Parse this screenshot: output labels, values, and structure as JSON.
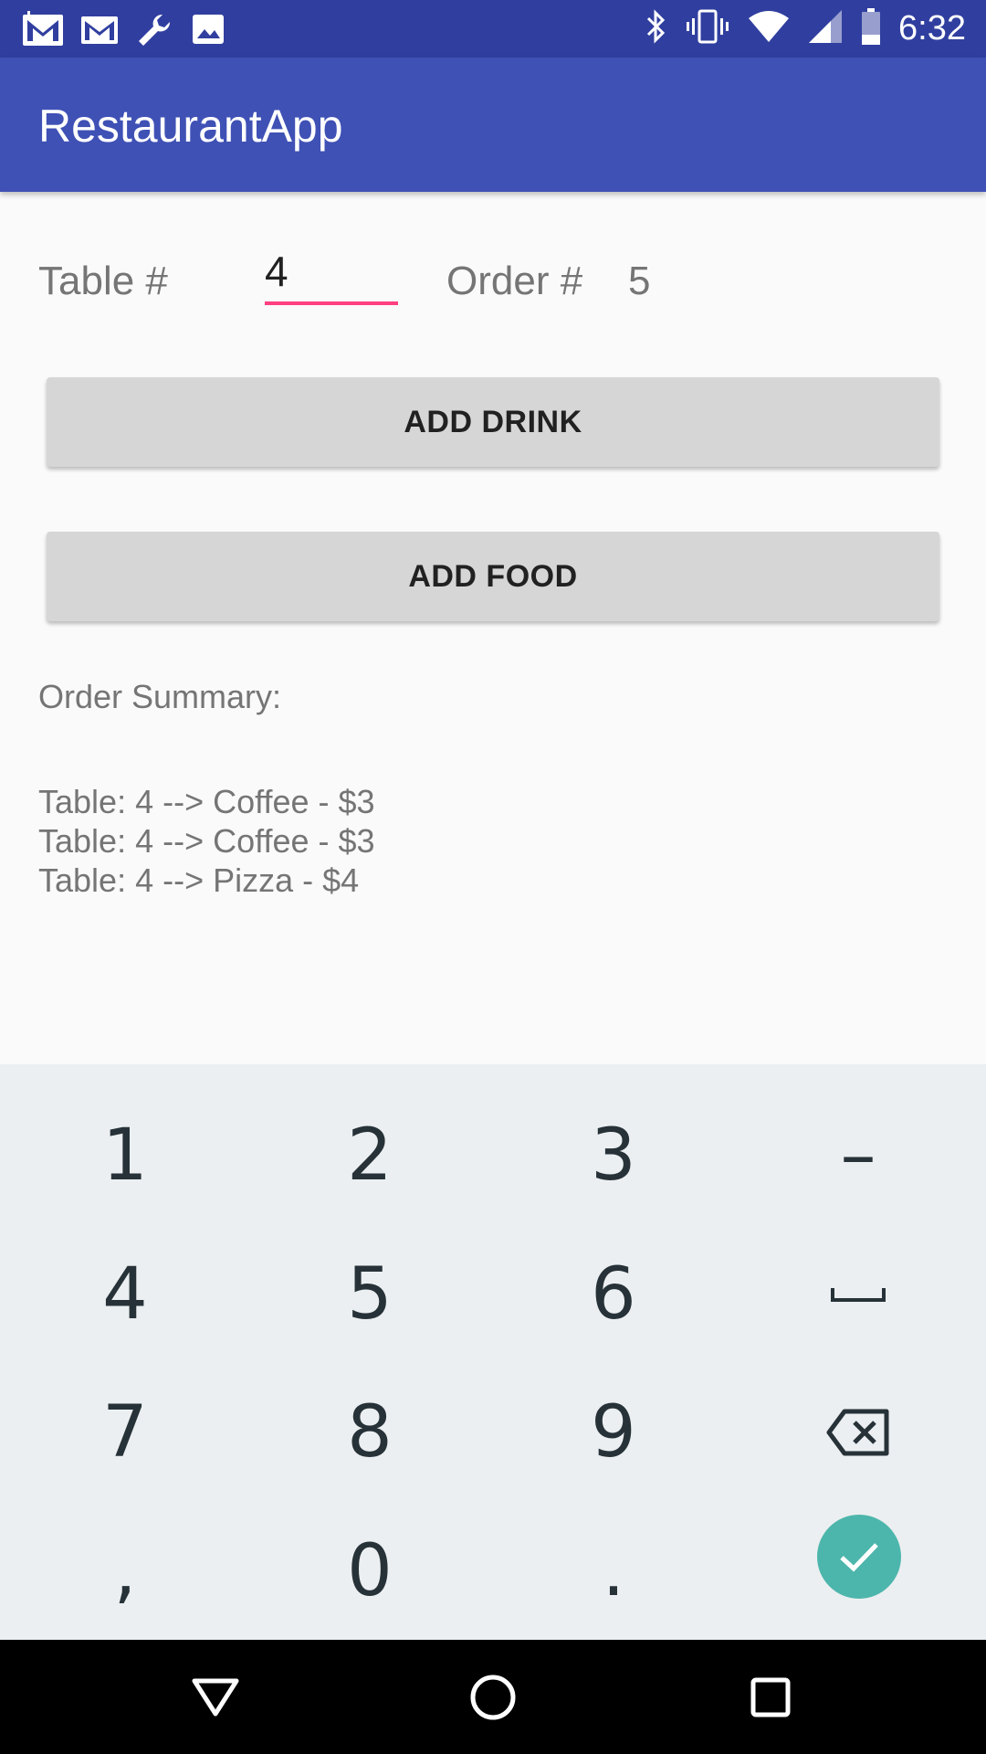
{
  "status_bar": {
    "time": "6:32",
    "left_icons": [
      "gmail-icon",
      "gmail-icon",
      "wrench-icon",
      "image-icon"
    ],
    "right_icons": [
      "bluetooth-icon",
      "vibrate-icon",
      "wifi-icon",
      "signal-icon",
      "battery-icon"
    ]
  },
  "app_bar": {
    "title": "RestaurantApp"
  },
  "form": {
    "table_label": "Table #",
    "table_value": "4",
    "order_label": "Order #",
    "order_value": "5"
  },
  "buttons": {
    "add_drink": "ADD DRINK",
    "add_food": "ADD FOOD"
  },
  "summary": {
    "title": "Order Summary:",
    "items": [
      "Table: 4 --> Coffee - $3",
      "Table: 4 --> Coffee - $3",
      "Table: 4 --> Pizza - $4"
    ]
  },
  "keyboard": {
    "keys": [
      "1",
      "2",
      "3",
      "–",
      "4",
      "5",
      "6",
      "space",
      "7",
      "8",
      "9",
      "backspace",
      ",",
      "0",
      ".",
      "done"
    ]
  },
  "colors": {
    "status_bar": "#303f9f",
    "app_bar": "#3f51b5",
    "accent": "#ff4081",
    "done": "#4db6ac"
  }
}
